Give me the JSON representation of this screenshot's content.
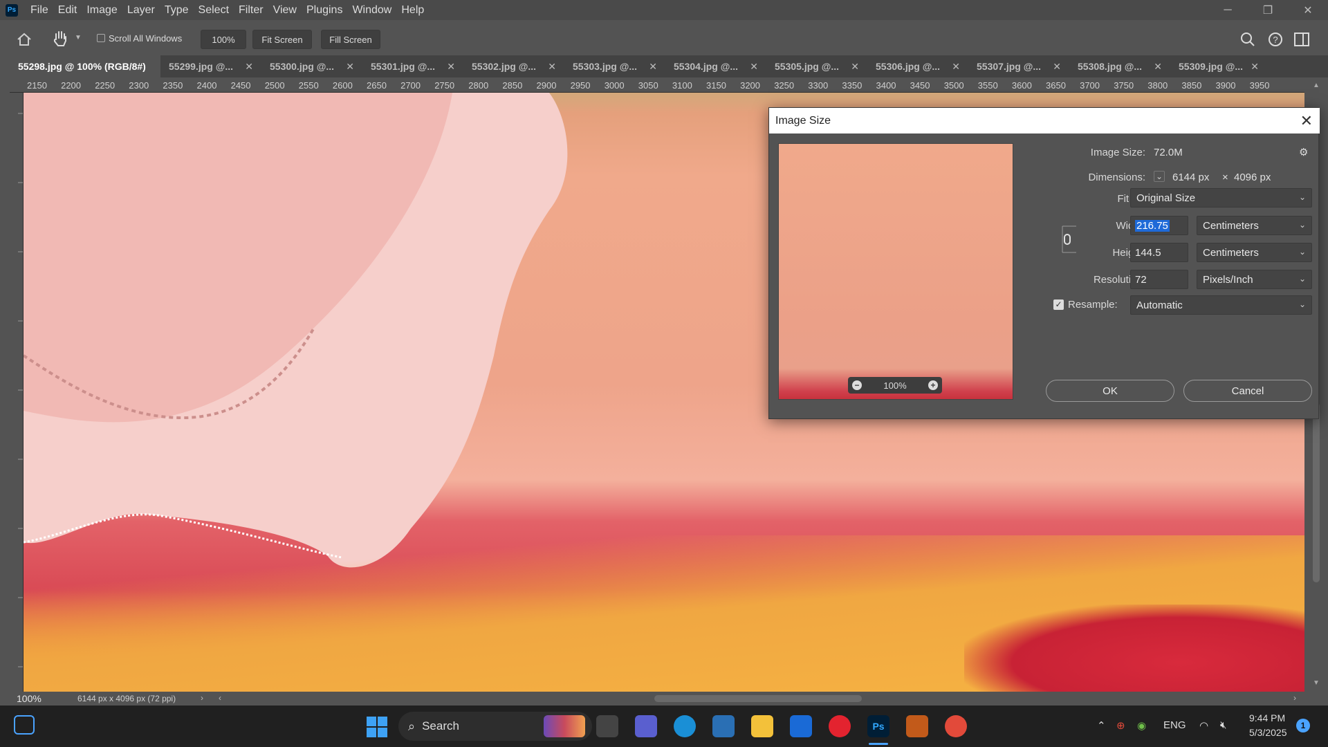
{
  "menu": [
    "File",
    "Edit",
    "Image",
    "Layer",
    "Type",
    "Select",
    "Filter",
    "View",
    "Plugins",
    "Window",
    "Help"
  ],
  "app": {
    "logo": "Ps"
  },
  "window_controls": {
    "minimize": "─",
    "restore": "❐",
    "close": "✕"
  },
  "options_bar": {
    "scroll_all_label": "Scroll All Windows",
    "scroll_all_checked": false,
    "zoom_btn": "100%",
    "fit_screen": "Fit Screen",
    "fill_screen": "Fill Screen"
  },
  "tabs": [
    {
      "label": "55298.jpg @ 100% (RGB/8#)",
      "active": true
    },
    {
      "label": "55299.jpg @..."
    },
    {
      "label": "55300.jpg @..."
    },
    {
      "label": "55301.jpg @..."
    },
    {
      "label": "55302.jpg @..."
    },
    {
      "label": "55303.jpg @..."
    },
    {
      "label": "55304.jpg @..."
    },
    {
      "label": "55305.jpg @..."
    },
    {
      "label": "55306.jpg @..."
    },
    {
      "label": "55307.jpg @..."
    },
    {
      "label": "55308.jpg @..."
    },
    {
      "label": "55309.jpg @..."
    }
  ],
  "ruler_ticks": [
    "2150",
    "2200",
    "2250",
    "2300",
    "2350",
    "2400",
    "2450",
    "2500",
    "2550",
    "2600",
    "2650",
    "2700",
    "2750",
    "2800",
    "2850",
    "2900",
    "2950",
    "3000",
    "3050",
    "3100",
    "3150",
    "3200",
    "3250",
    "3300",
    "3350",
    "3400",
    "3450",
    "3500",
    "3550",
    "3600",
    "3650",
    "3700",
    "3750",
    "3800",
    "3850",
    "3900",
    "3950"
  ],
  "status": {
    "zoom": "100%",
    "doc_info": "6144 px x 4096 px (72 ppi)"
  },
  "dialog": {
    "title": "Image Size",
    "image_size_label": "Image Size:",
    "image_size_value": "72.0M",
    "dimensions_label": "Dimensions:",
    "dim_w": "6144 px",
    "dim_x": "×",
    "dim_h": "4096 px",
    "fit_label": "Fit T...",
    "fit_value": "Original Size",
    "width_label": "Width:",
    "width_value": "216.75",
    "width_unit": "Centimeters",
    "height_label": "Height:",
    "height_value": "144.5",
    "height_unit": "Centimeters",
    "resolution_label": "Resolution:",
    "resolution_value": "72",
    "resolution_unit": "Pixels/Inch",
    "resample_label": "Resample:",
    "resample_checked": true,
    "resample_value": "Automatic",
    "preview_zoom": "100%",
    "ok": "OK",
    "cancel": "Cancel"
  },
  "taskbar": {
    "search": "Search",
    "lang": "ENG",
    "time": "9:44 PM",
    "date": "5/3/2025",
    "notification_count": "1"
  }
}
